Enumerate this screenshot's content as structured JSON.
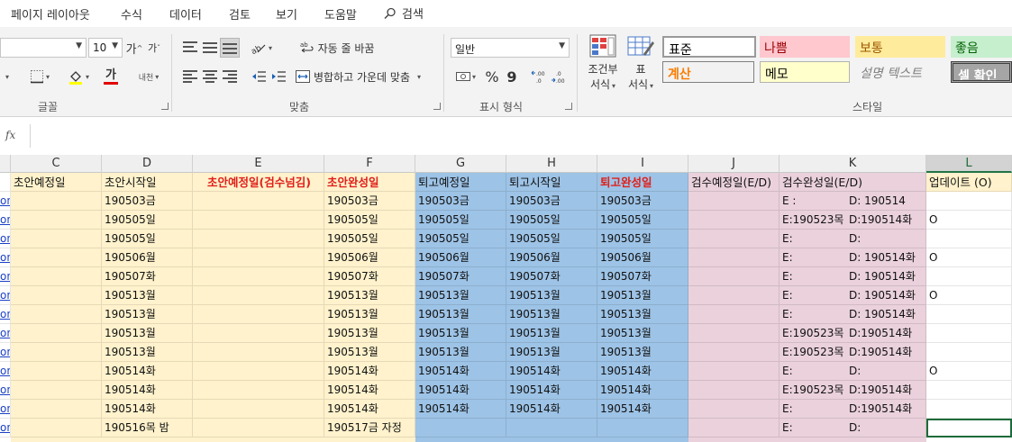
{
  "tabs": [
    "페이지 레이아웃",
    "수식",
    "데이터",
    "검토",
    "보기",
    "도움말"
  ],
  "search_label": "검색",
  "ribbon": {
    "font_size": "10",
    "grow_font": "가",
    "shrink_font": "가",
    "wrap_text": "자동 줄 바꿈",
    "merge_center": "병합하고 가운데 맞춤",
    "number_format": "일반",
    "percent": "%",
    "comma": "9",
    "text_color_glyph": "가",
    "phonetic": "내천",
    "conditional_format": "조건부",
    "conditional_format_2": "서식",
    "format_table": "표",
    "format_table_2": "서식",
    "groups": {
      "font": "글꼴",
      "align": "맞춤",
      "number": "표시 형식",
      "styles": "스타일"
    },
    "styles": {
      "normal": "표준",
      "bad": "나쁨",
      "neutral": "보통",
      "good": "좋음",
      "calc": "계산",
      "memo": "메모",
      "explanatory": "설명 텍스트",
      "check": "셀 확인"
    }
  },
  "formula_bar": {
    "fx": "fx",
    "value": ""
  },
  "columns": [
    "C",
    "D",
    "E",
    "F",
    "G",
    "H",
    "I",
    "J",
    "K",
    "L"
  ],
  "selected_column": "L",
  "headers": {
    "C": "초안예정일",
    "D": "초안시작일",
    "E": "초안예정일(검수넘김)",
    "F": "초안완성일",
    "G": "퇴고예정일",
    "H": "퇴고시작일",
    "I": "퇴고완성일",
    "J": "검수예정일(E/D)",
    "K": "검수완성일(E/D)",
    "L": "업데이트 (O)"
  },
  "link_text": "on",
  "rows": [
    {
      "D": "190503금",
      "F": "190503금",
      "G": "190503금",
      "H": "190503금",
      "I": "190503금",
      "K_e": "E :",
      "K_d": "D:  190514",
      "L": ""
    },
    {
      "D": "190505일",
      "F": "190505일",
      "G": "190505일",
      "H": "190505일",
      "I": "190505일",
      "K_e": "E:190523목",
      "K_d": "D:190514화",
      "L": "O"
    },
    {
      "D": "190505일",
      "F": "190505일",
      "G": "190505일",
      "H": "190505일",
      "I": "190505일",
      "K_e": "E:",
      "K_d": "D:",
      "L": ""
    },
    {
      "D": "190506월",
      "F": "190506월",
      "G": "190506월",
      "H": "190506월",
      "I": "190506월",
      "K_e": "E:",
      "K_d": "D: 190514화",
      "L": "O"
    },
    {
      "D": "190507화",
      "F": "190507화",
      "G": "190507화",
      "H": "190507화",
      "I": "190507화",
      "K_e": "E:",
      "K_d": "D: 190514화",
      "L": ""
    },
    {
      "D": "190513월",
      "F": "190513월",
      "G": "190513월",
      "H": "190513월",
      "I": "190513월",
      "K_e": "E:",
      "K_d": "D: 190514화",
      "L": "O"
    },
    {
      "D": "190513월",
      "F": "190513월",
      "G": "190513월",
      "H": "190513월",
      "I": "190513월",
      "K_e": "E:",
      "K_d": "D: 190514화",
      "L": ""
    },
    {
      "D": "190513월",
      "F": "190513월",
      "G": "190513월",
      "H": "190513월",
      "I": "190513월",
      "K_e": "E:190523목",
      "K_d": "D:190514화",
      "L": ""
    },
    {
      "D": "190513월",
      "F": "190513월",
      "G": "190513월",
      "H": "190513월",
      "I": "190513월",
      "K_e": "E:190523목",
      "K_d": "D:190514화",
      "L": ""
    },
    {
      "D": "190514화",
      "F": "190514화",
      "G": "190514화",
      "H": "190514화",
      "I": "190514화",
      "K_e": "E:",
      "K_d": "D:",
      "L": "O"
    },
    {
      "D": "190514화",
      "F": "190514화",
      "G": "190514화",
      "H": "190514화",
      "I": "190514화",
      "K_e": "E:190523목",
      "K_d": "D:190514화",
      "L": ""
    },
    {
      "D": "190514화",
      "F": "190514화",
      "G": "190514화",
      "H": "190514화",
      "I": "190514화",
      "K_e": "E:",
      "K_d": "D:190514화",
      "L": ""
    },
    {
      "D": "190516목 밤",
      "F": "190517금 자정",
      "G": "",
      "H": "",
      "I": "",
      "K_e": "E:",
      "K_d": "D:",
      "L": ""
    }
  ],
  "colors": {
    "yellow_fill": "#fff2cc",
    "blue_fill": "#9dc3e6",
    "pink_fill": "#ead1dc",
    "accent_green": "#217346",
    "header_red": "#e0201b"
  }
}
